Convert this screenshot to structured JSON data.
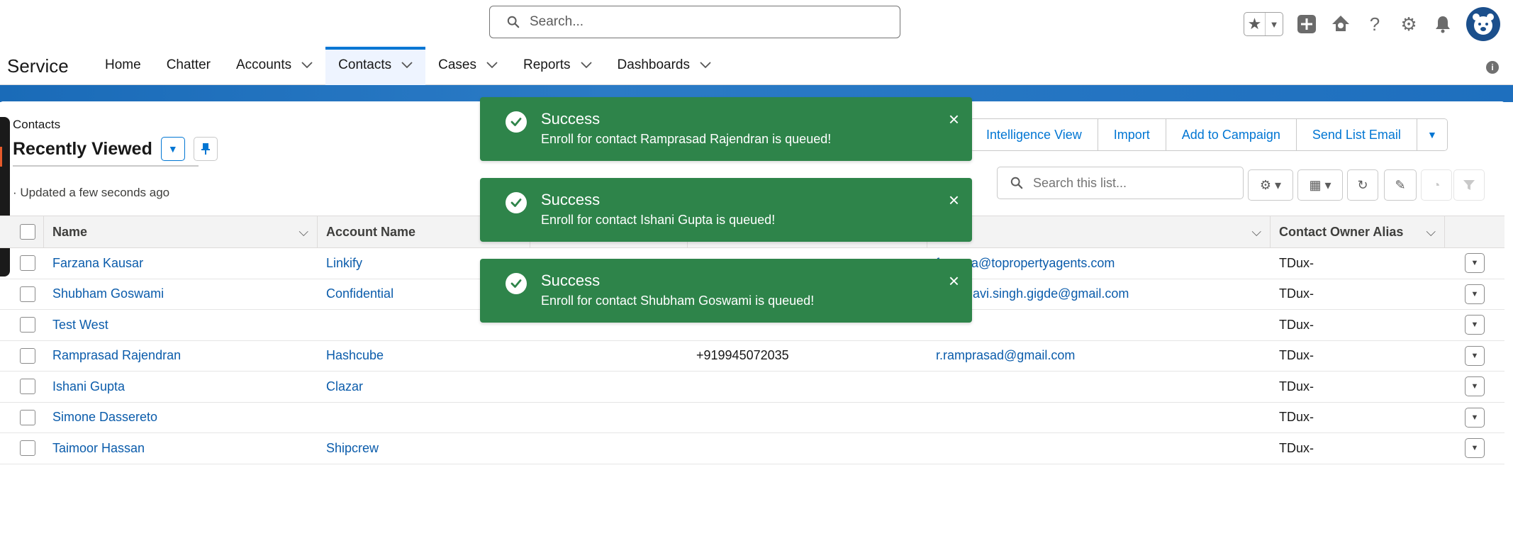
{
  "header": {
    "search_placeholder": "Search...",
    "icons": [
      "star-icon",
      "plus-icon",
      "trailhead-icon",
      "help-icon",
      "gear-icon",
      "bell-icon",
      "avatar"
    ]
  },
  "nav": {
    "app_name": "Service",
    "items": [
      {
        "label": "Home",
        "has_menu": false,
        "active": false
      },
      {
        "label": "Chatter",
        "has_menu": false,
        "active": false
      },
      {
        "label": "Accounts",
        "has_menu": true,
        "active": false
      },
      {
        "label": "Contacts",
        "has_menu": true,
        "active": true
      },
      {
        "label": "Cases",
        "has_menu": true,
        "active": false
      },
      {
        "label": "Reports",
        "has_menu": true,
        "active": false
      },
      {
        "label": "Dashboards",
        "has_menu": true,
        "active": false
      }
    ]
  },
  "list": {
    "object_label": "Contacts",
    "title": "Recently Viewed",
    "updated": "· Updated a few seconds ago",
    "search_placeholder": "Search this list..."
  },
  "actions": {
    "intelligence_view": "Intelligence View",
    "import": "Import",
    "add_to_campaign": "Add to Campaign",
    "send_list_email": "Send List Email"
  },
  "table": {
    "headers": {
      "name": "Name",
      "account": "Account Name",
      "owner": "Contact Owner Alias"
    },
    "rows": [
      {
        "name": "Farzana Kausar",
        "account": "Linkify",
        "phone": "",
        "email": "farzana@topropertyagents.com",
        "owner": "TDux-"
      },
      {
        "name": "Shubham Goswami",
        "account": "Confidential",
        "phone": "",
        "email": "vaishnavi.singh.gigde@gmail.com",
        "owner": "TDux-"
      },
      {
        "name": "Test West",
        "account": "",
        "phone": "",
        "email": "",
        "owner": "TDux-"
      },
      {
        "name": "Ramprasad Rajendran",
        "account": "Hashcube",
        "phone": "+919945072035",
        "email": "r.ramprasad@gmail.com",
        "owner": "TDux-"
      },
      {
        "name": "Ishani Gupta",
        "account": "Clazar",
        "phone": "",
        "email": "",
        "owner": "TDux-"
      },
      {
        "name": "Simone Dassereto",
        "account": "",
        "phone": "",
        "email": "",
        "owner": "TDux-"
      },
      {
        "name": "Taimoor Hassan",
        "account": "Shipcrew",
        "phone": "",
        "email": "",
        "owner": "TDux-"
      }
    ]
  },
  "toasts": [
    {
      "title": "Success",
      "message": "Enroll for contact Ramprasad Rajendran is queued!"
    },
    {
      "title": "Success",
      "message": "Enroll for contact Ishani Gupta is queued!"
    },
    {
      "title": "Success",
      "message": "Enroll for contact Shubham Goswami is queued!"
    }
  ],
  "colors": {
    "brand": "#0176d3",
    "link": "#0b5cab",
    "success": "#2e844a"
  }
}
